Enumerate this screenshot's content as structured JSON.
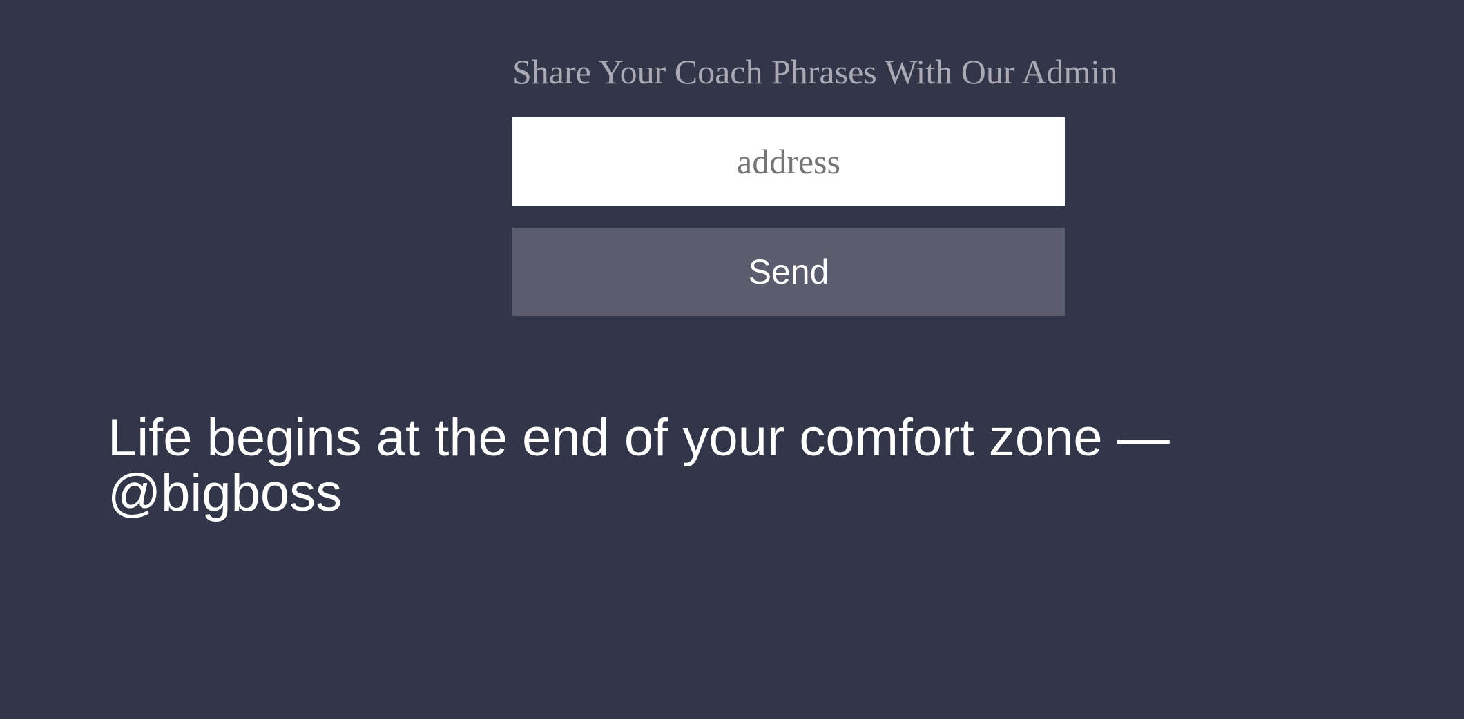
{
  "form": {
    "heading": "Share Your Coach Phrases With Our Admin",
    "address_placeholder": "address",
    "address_value": "",
    "send_label": "Send"
  },
  "quote": {
    "text": "Life begins at the end of your comfort zone — @bigboss"
  },
  "colors": {
    "background": "#333548",
    "heading": "#a9aab6",
    "input_background": "#ffffff",
    "button_background": "#5b5d6e",
    "quote_text": "#ffffff"
  }
}
